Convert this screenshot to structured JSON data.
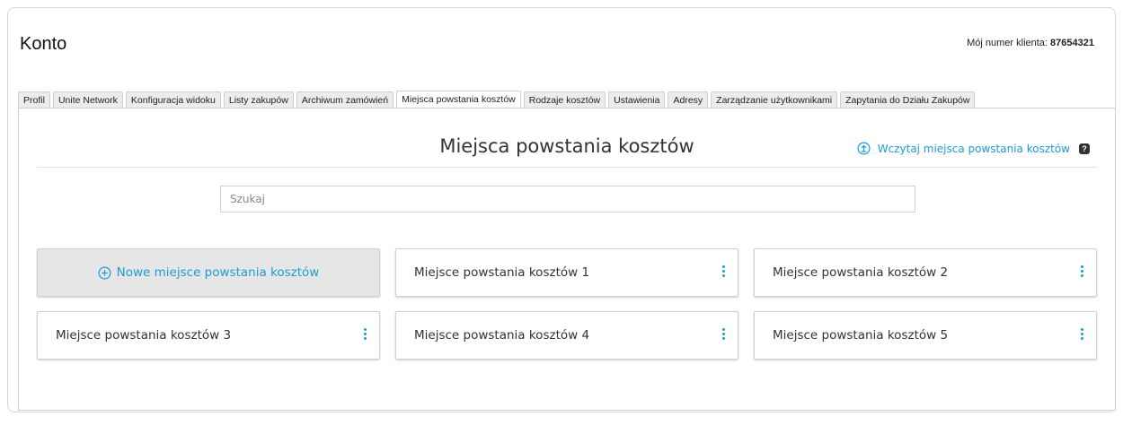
{
  "header": {
    "title": "Konto",
    "customer_label": "Mój numer klienta:",
    "customer_number": "87654321"
  },
  "tabs": [
    {
      "label": "Profil"
    },
    {
      "label": "Unite Network"
    },
    {
      "label": "Konfiguracja widoku"
    },
    {
      "label": "Listy zakupów"
    },
    {
      "label": "Archiwum zamówień"
    },
    {
      "label": "Miejsca powstania kosztów",
      "active": true
    },
    {
      "label": "Rodzaje kosztów"
    },
    {
      "label": "Ustawienia"
    },
    {
      "label": "Adresy"
    },
    {
      "label": "Zarządzanie użytkownikami"
    },
    {
      "label": "Zapytania do Działu Zakupów"
    }
  ],
  "main": {
    "title": "Miejsca powstania kosztów",
    "load_link": "Wczytaj miejsca powstania kosztów",
    "help_label": "?",
    "search_placeholder": "Szukaj",
    "new_card_label": "Nowe miejsce powstania kosztów",
    "cards": [
      "Miejsce powstania kosztów 1",
      "Miejsce powstania kosztów 2",
      "Miejsce powstania kosztów 3",
      "Miejsce powstania kosztów 4",
      "Miejsce powstania kosztów 5"
    ]
  },
  "colors": {
    "accent": "#1e9bd7",
    "new_card_bg": "#e6e6e6"
  },
  "icons": {
    "load_link": "upload-circle-icon",
    "new_card": "plus-circle-icon",
    "card_menu": "kebab-menu-icon"
  }
}
